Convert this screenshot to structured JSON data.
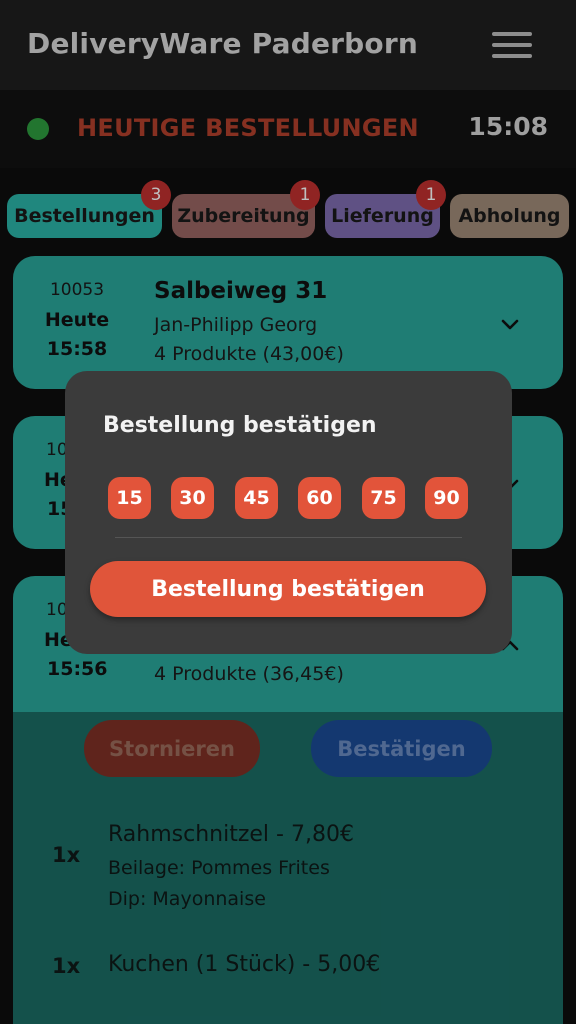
{
  "app": {
    "title": "DeliveryWare Paderborn"
  },
  "status": {
    "title": "HEUTIGE BESTELLUNGEN",
    "time": "15:08",
    "dot_color": "#2e9d3f"
  },
  "tabs": [
    {
      "label": "Bestellungen",
      "badge": "3"
    },
    {
      "label": "Zubereitung",
      "badge": "1"
    },
    {
      "label": "Lieferung",
      "badge": "1"
    },
    {
      "label": "Abholung",
      "badge": ""
    }
  ],
  "orders": [
    {
      "id": "10053",
      "day": "Heute",
      "time": "15:58",
      "street": "Salbeiweg 31",
      "name": "Jan-Philipp Georg",
      "products": "4 Produkte (43,00€)"
    },
    {
      "id": "10",
      "day": "He",
      "time": "15"
    },
    {
      "id": "10",
      "day": "He",
      "time": "15:56",
      "products": "4 Produkte (36,45€)",
      "actions": {
        "cancel": "Stornieren",
        "confirm": "Bestätigen"
      },
      "items": [
        {
          "qty": "1x",
          "name": "Rahmschnitzel - 7,80€",
          "details": [
            "Beilage: Pommes Frites",
            "Dip: Mayonnaise"
          ]
        },
        {
          "qty": "1x",
          "name": "Kuchen (1 Stück) - 5,00€",
          "details": []
        }
      ]
    }
  ],
  "dialog": {
    "title": "Bestellung bestätigen",
    "times": [
      "15",
      "30",
      "45",
      "60",
      "75",
      "90"
    ],
    "confirm_label": "Bestellung bestätigen"
  },
  "colors": {
    "accent": "#e0553a",
    "card": "#2aa79b",
    "badge": "#c0302f"
  }
}
